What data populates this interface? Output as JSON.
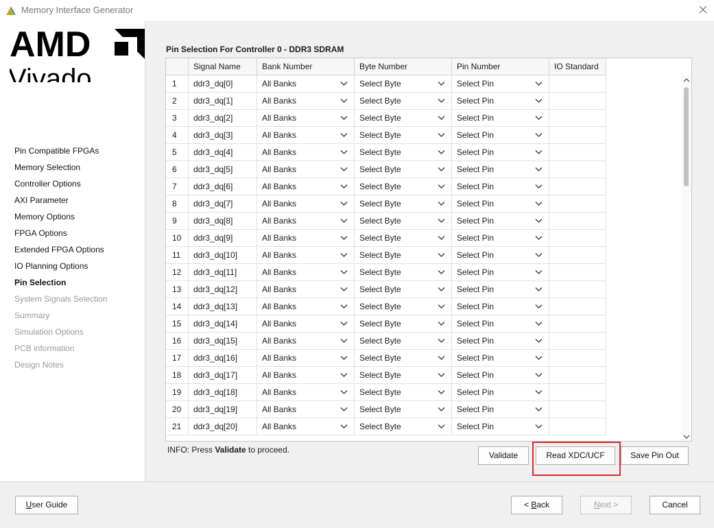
{
  "window": {
    "title": "Memory Interface Generator"
  },
  "sidebar": {
    "items": [
      {
        "label": "Pin Compatible FPGAs",
        "state": "normal"
      },
      {
        "label": "Memory Selection",
        "state": "normal"
      },
      {
        "label": "Controller Options",
        "state": "normal"
      },
      {
        "label": "AXI Parameter",
        "state": "normal"
      },
      {
        "label": "Memory Options",
        "state": "normal"
      },
      {
        "label": "FPGA Options",
        "state": "normal"
      },
      {
        "label": "Extended FPGA Options",
        "state": "normal"
      },
      {
        "label": "IO Planning Options",
        "state": "normal"
      },
      {
        "label": "Pin Selection",
        "state": "active"
      },
      {
        "label": "System Signals Selection",
        "state": "disabled"
      },
      {
        "label": "Summary",
        "state": "disabled"
      },
      {
        "label": "Simulation Options",
        "state": "disabled"
      },
      {
        "label": "PCB information",
        "state": "disabled"
      },
      {
        "label": "Design Notes",
        "state": "disabled"
      }
    ]
  },
  "main": {
    "title": "Pin Selection For Controller 0 - DDR3 SDRAM",
    "table": {
      "headers": [
        "",
        "Signal Name",
        "Bank Number",
        "Byte Number",
        "Pin Number",
        "IO Standard"
      ],
      "rows": [
        {
          "num": "1",
          "signal": "ddr3_dq[0]",
          "bank": "All Banks",
          "byte": "Select Byte",
          "pin": "Select Pin",
          "io": ""
        },
        {
          "num": "2",
          "signal": "ddr3_dq[1]",
          "bank": "All Banks",
          "byte": "Select Byte",
          "pin": "Select Pin",
          "io": ""
        },
        {
          "num": "3",
          "signal": "ddr3_dq[2]",
          "bank": "All Banks",
          "byte": "Select Byte",
          "pin": "Select Pin",
          "io": ""
        },
        {
          "num": "4",
          "signal": "ddr3_dq[3]",
          "bank": "All Banks",
          "byte": "Select Byte",
          "pin": "Select Pin",
          "io": ""
        },
        {
          "num": "5",
          "signal": "ddr3_dq[4]",
          "bank": "All Banks",
          "byte": "Select Byte",
          "pin": "Select Pin",
          "io": ""
        },
        {
          "num": "6",
          "signal": "ddr3_dq[5]",
          "bank": "All Banks",
          "byte": "Select Byte",
          "pin": "Select Pin",
          "io": ""
        },
        {
          "num": "7",
          "signal": "ddr3_dq[6]",
          "bank": "All Banks",
          "byte": "Select Byte",
          "pin": "Select Pin",
          "io": ""
        },
        {
          "num": "8",
          "signal": "ddr3_dq[7]",
          "bank": "All Banks",
          "byte": "Select Byte",
          "pin": "Select Pin",
          "io": ""
        },
        {
          "num": "9",
          "signal": "ddr3_dq[8]",
          "bank": "All Banks",
          "byte": "Select Byte",
          "pin": "Select Pin",
          "io": ""
        },
        {
          "num": "10",
          "signal": "ddr3_dq[9]",
          "bank": "All Banks",
          "byte": "Select Byte",
          "pin": "Select Pin",
          "io": ""
        },
        {
          "num": "11",
          "signal": "ddr3_dq[10]",
          "bank": "All Banks",
          "byte": "Select Byte",
          "pin": "Select Pin",
          "io": ""
        },
        {
          "num": "12",
          "signal": "ddr3_dq[11]",
          "bank": "All Banks",
          "byte": "Select Byte",
          "pin": "Select Pin",
          "io": ""
        },
        {
          "num": "13",
          "signal": "ddr3_dq[12]",
          "bank": "All Banks",
          "byte": "Select Byte",
          "pin": "Select Pin",
          "io": ""
        },
        {
          "num": "14",
          "signal": "ddr3_dq[13]",
          "bank": "All Banks",
          "byte": "Select Byte",
          "pin": "Select Pin",
          "io": ""
        },
        {
          "num": "15",
          "signal": "ddr3_dq[14]",
          "bank": "All Banks",
          "byte": "Select Byte",
          "pin": "Select Pin",
          "io": ""
        },
        {
          "num": "16",
          "signal": "ddr3_dq[15]",
          "bank": "All Banks",
          "byte": "Select Byte",
          "pin": "Select Pin",
          "io": ""
        },
        {
          "num": "17",
          "signal": "ddr3_dq[16]",
          "bank": "All Banks",
          "byte": "Select Byte",
          "pin": "Select Pin",
          "io": ""
        },
        {
          "num": "18",
          "signal": "ddr3_dq[17]",
          "bank": "All Banks",
          "byte": "Select Byte",
          "pin": "Select Pin",
          "io": ""
        },
        {
          "num": "19",
          "signal": "ddr3_dq[18]",
          "bank": "All Banks",
          "byte": "Select Byte",
          "pin": "Select Pin",
          "io": ""
        },
        {
          "num": "20",
          "signal": "ddr3_dq[19]",
          "bank": "All Banks",
          "byte": "Select Byte",
          "pin": "Select Pin",
          "io": ""
        },
        {
          "num": "21",
          "signal": "ddr3_dq[20]",
          "bank": "All Banks",
          "byte": "Select Byte",
          "pin": "Select Pin",
          "io": ""
        }
      ]
    },
    "info": {
      "prefix": "INFO: Press ",
      "keyword": "Validate",
      "suffix": " to proceed."
    },
    "buttons": {
      "validate": "Validate",
      "read_xdc": "Read XDC/UCF",
      "save_pin_out": "Save Pin Out"
    }
  },
  "footer": {
    "user_guide": {
      "mnemonic": "U",
      "rest": "ser Guide"
    },
    "back": {
      "prefix": "< ",
      "mnemonic": "B",
      "rest": "ack"
    },
    "next": {
      "mnemonic": "N",
      "rest": "ext >"
    },
    "cancel": "Cancel"
  },
  "colors": {
    "highlight": "#e0292b",
    "amd_black": "#000000",
    "disabled_text": "#999999"
  }
}
